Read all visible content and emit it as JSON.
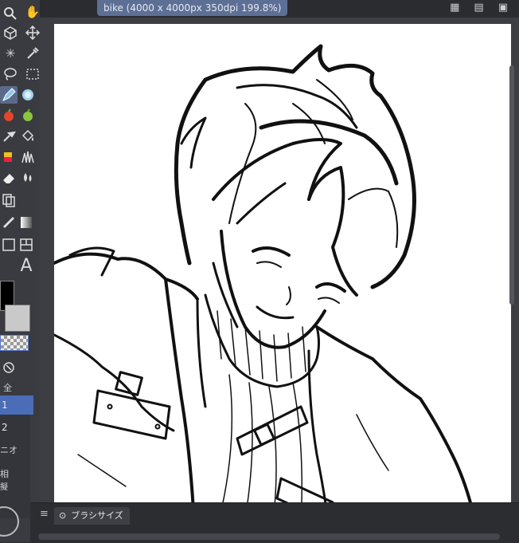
{
  "document": {
    "tab_title": "bike (4000 x 4000px 350dpi 199.8%)"
  },
  "toolbar": {
    "tools": [
      "hand-icon",
      "magnifier-icon",
      "object-cube-icon",
      "move-icon",
      "sparkle-icon",
      "eyedropper-icon",
      "lasso-icon",
      "marquee-icon",
      "pen-icon",
      "blur-icon",
      "apple-red-icon",
      "apple-green-icon",
      "brush-icon",
      "fill-bucket-icon",
      "airbrush-icon",
      "grass-decoration-icon",
      "eraser-icon",
      "water-drop-icon",
      "layer-copy-icon",
      "gradient-icon",
      "ruler-icon",
      "frame-icon",
      "text-icon"
    ],
    "text_tool_glyph": "A"
  },
  "layers": {
    "items": [
      {
        "label": "1",
        "selected": true
      },
      {
        "label": "2",
        "selected": false
      }
    ],
    "partial_label_a": "全",
    "partial_label_b": "ニオ",
    "partial_label_c": "相",
    "partial_label_d": "擬"
  },
  "bottom_panel": {
    "brush_size_label": "ブラシサイズ"
  },
  "colors": {
    "accent": "#4b6cb7",
    "tab": "#5d6f95",
    "panel": "#3a3b40"
  }
}
